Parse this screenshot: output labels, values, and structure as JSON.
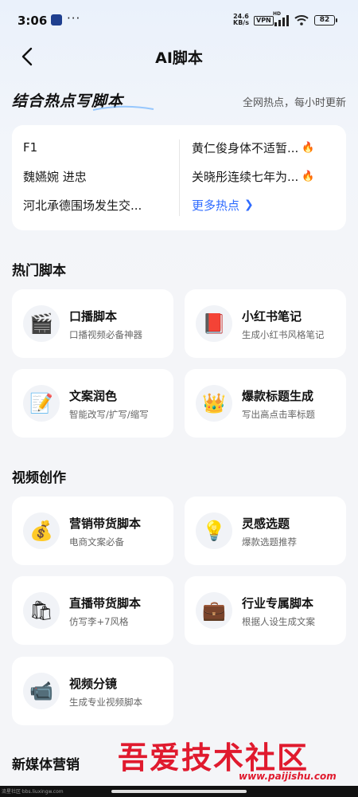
{
  "status": {
    "time": "3:06",
    "dots": "···",
    "speed_value": "24.6",
    "speed_unit": "KB/s",
    "vpn": "VPN",
    "hd": "HD",
    "battery": "82"
  },
  "nav": {
    "title": "AI脚本"
  },
  "hot": {
    "title": "结合热点写脚本",
    "subtitle": "全网热点，每小时更新",
    "left_items": [
      "F1",
      "魏嬿婉 进忠",
      "河北承德围场发生交..."
    ],
    "right_items": [
      "黄仁俊身体不适暂...",
      "关晓彤连续七年为..."
    ],
    "more_label": "更多热点"
  },
  "hot_scripts": {
    "title": "热门脚本",
    "tiles": [
      {
        "title": "口播脚本",
        "desc": "口播视频必备神器",
        "icon": "clapperboard-icon",
        "glyph": "🎬"
      },
      {
        "title": "小红书笔记",
        "desc": "生成小红书风格笔记",
        "icon": "red-book-icon",
        "glyph": "📕"
      },
      {
        "title": "文案润色",
        "desc": "智能改写/扩写/缩写",
        "icon": "memo-pencil-icon",
        "glyph": "📝"
      },
      {
        "title": "爆款标题生成",
        "desc": "写出高点击率标题",
        "icon": "crown-icon",
        "glyph": "👑"
      }
    ]
  },
  "video": {
    "title": "视频创作",
    "tiles": [
      {
        "title": "营销带货脚本",
        "desc": "电商文案必备",
        "icon": "money-bag-icon",
        "glyph": "💰"
      },
      {
        "title": "灵感选题",
        "desc": "爆款选题推荐",
        "icon": "light-bulb-icon",
        "glyph": "💡"
      },
      {
        "title": "直播带货脚本",
        "desc": "仿写李+7风格",
        "icon": "shopping-bags-icon",
        "glyph": "🛍"
      },
      {
        "title": "行业专属脚本",
        "desc": "根据人设生成文案",
        "icon": "briefcase-icon",
        "glyph": "💼"
      },
      {
        "title": "视频分镜",
        "desc": "生成专业视频脚本",
        "icon": "video-camera-icon",
        "glyph": "📹"
      }
    ]
  },
  "new_media": {
    "title": "新媒体营销"
  },
  "watermark": {
    "text": "吾爱技术社区",
    "url": "www.paijishu.com",
    "credit": "流星社区·bbs.liuxingw.com"
  },
  "colors": {
    "accent": "#2f6bff",
    "fire": "#ff6a1a",
    "watermark": "#e01a2e"
  }
}
